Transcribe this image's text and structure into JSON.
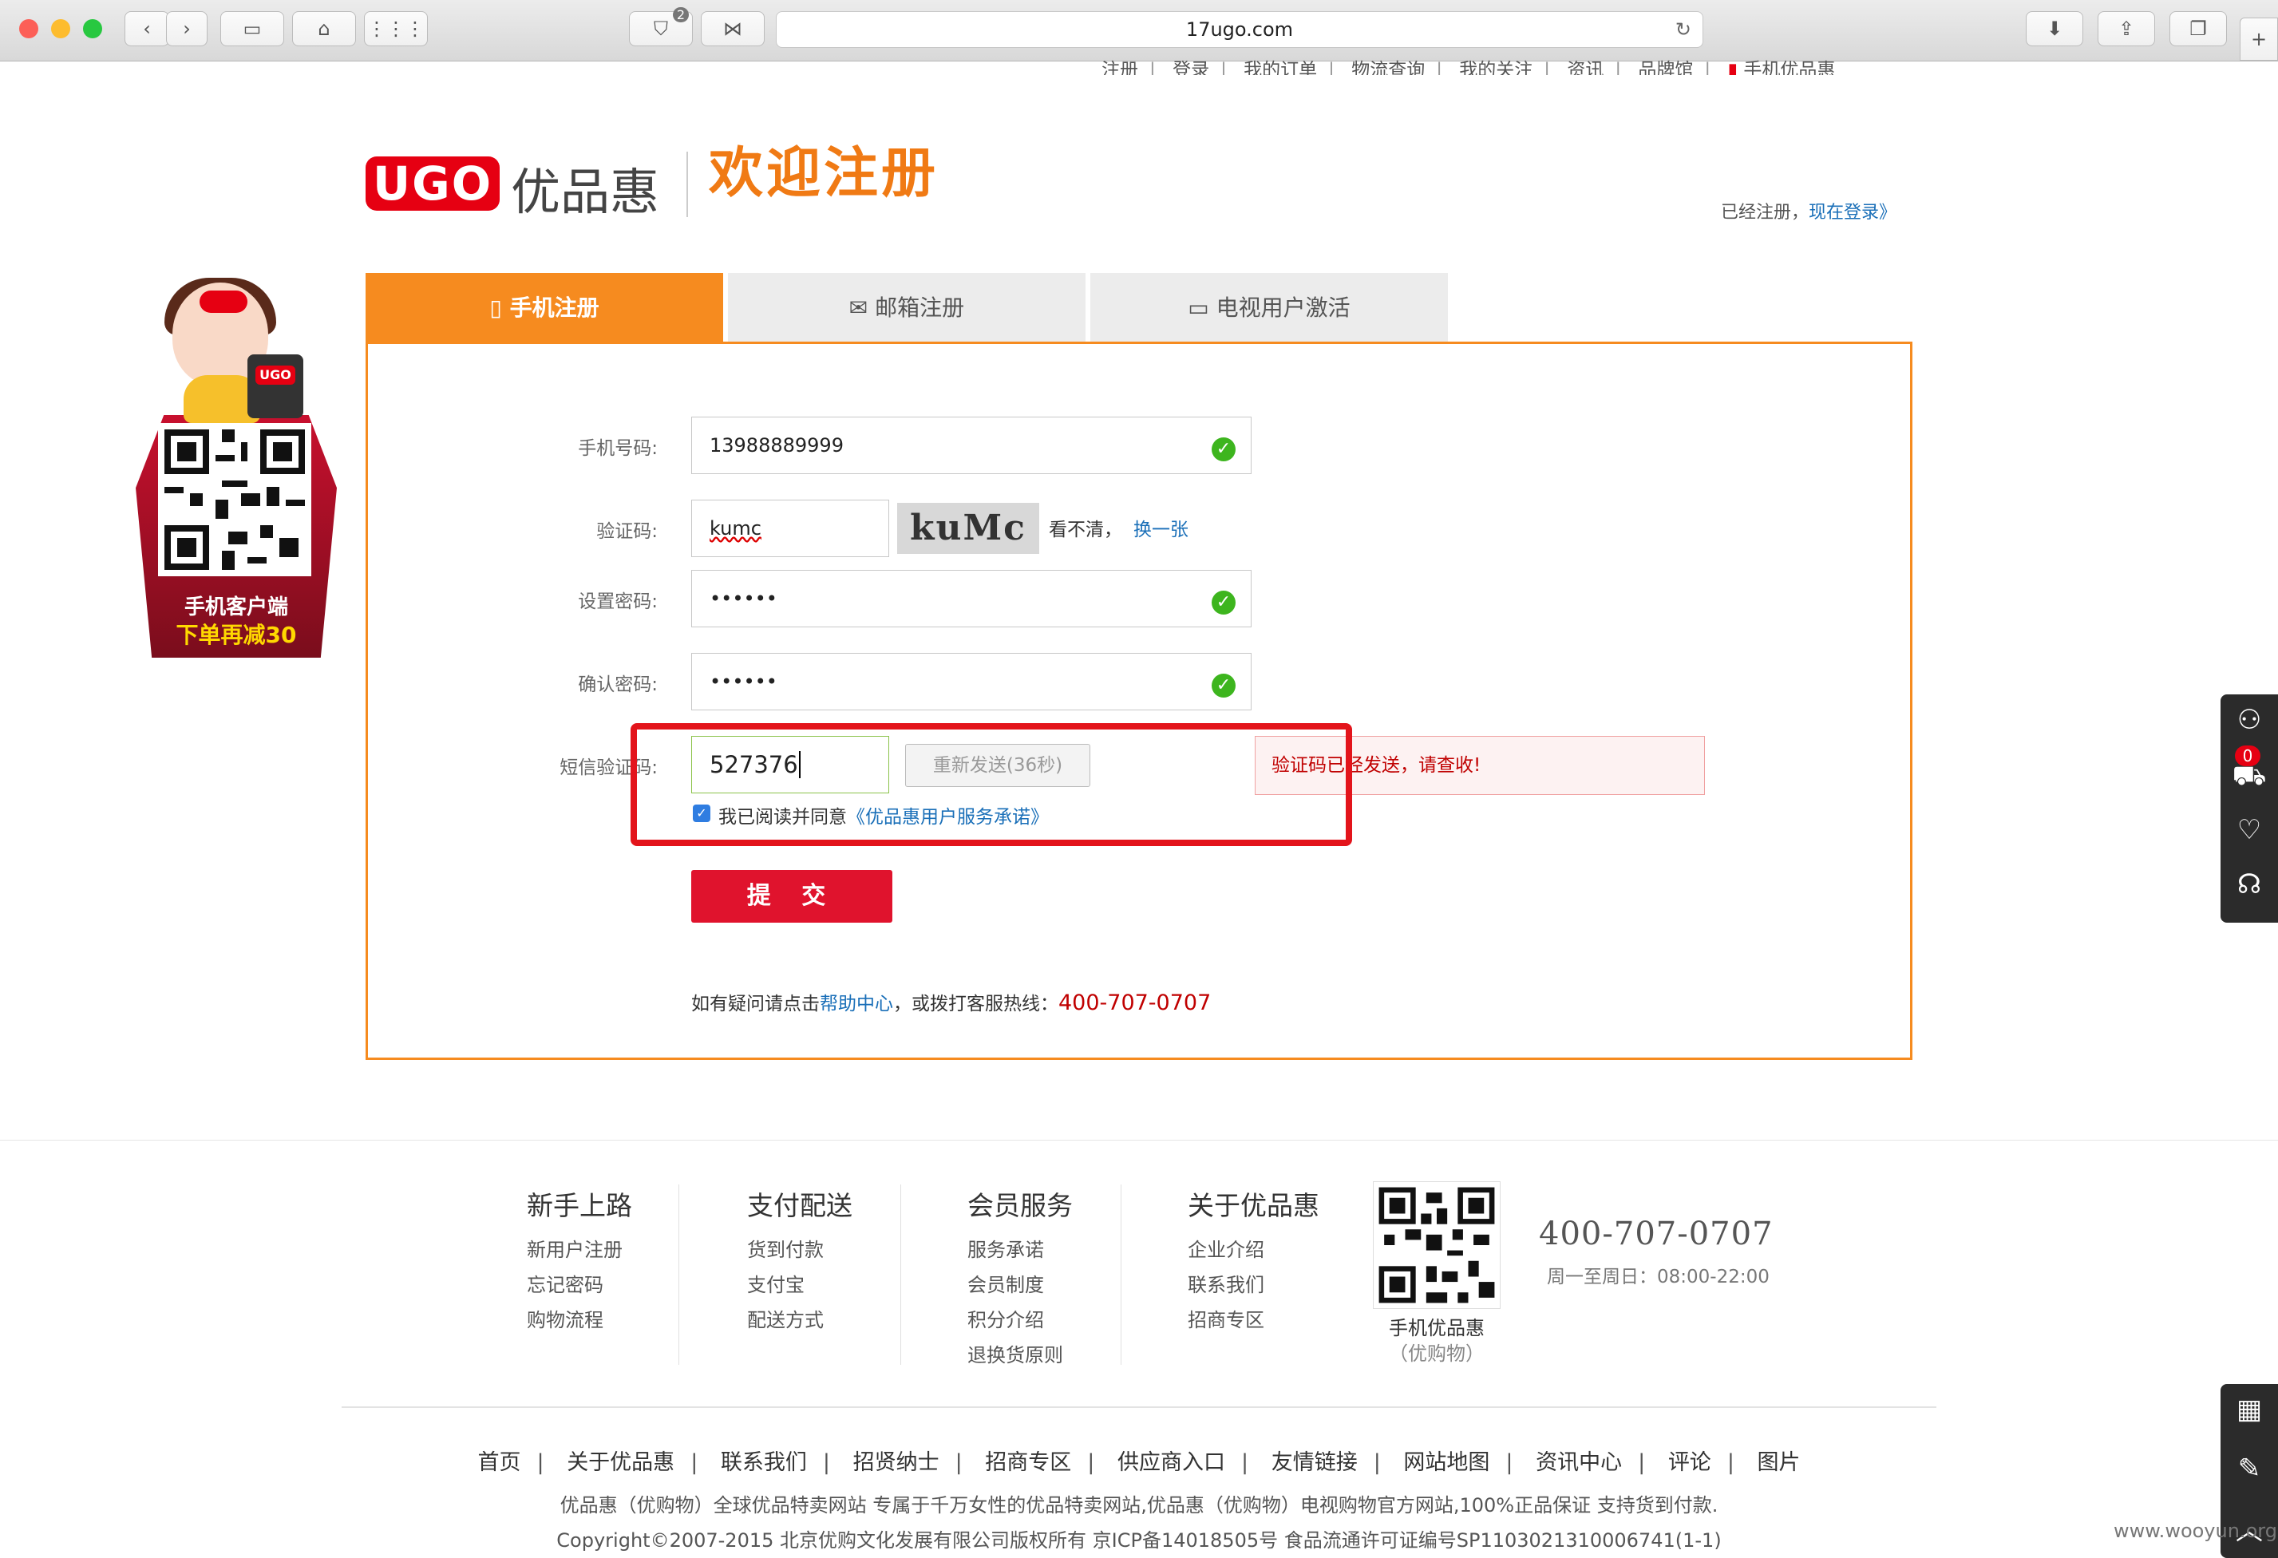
{
  "browser": {
    "url": "17ugo.com",
    "shield_badge": "2"
  },
  "topnav": {
    "items": [
      "注册",
      "登录",
      "我的订单",
      "物流查询",
      "我的关注",
      "资讯",
      "品牌馆",
      "手机优品惠"
    ]
  },
  "header": {
    "logo_text": "UGO",
    "logo_cn": "优品惠",
    "welcome": "欢迎注册",
    "already_text": "已经注册，",
    "login_link": "现在登录》"
  },
  "tabs": [
    {
      "label": "手机注册",
      "active": true,
      "icon": "phone-icon"
    },
    {
      "label": "邮箱注册",
      "active": false,
      "icon": "mail-icon"
    },
    {
      "label": "电视用户激活",
      "active": false,
      "icon": "tv-icon"
    }
  ],
  "form": {
    "phone_label": "手机号码:",
    "phone_value": "13988889999",
    "captcha_label": "验证码:",
    "captcha_value": "kumc",
    "captcha_image_text": "kuMc",
    "captcha_unclear": "看不清，",
    "captcha_refresh": "换一张",
    "password_label": "设置密码:",
    "password_value": "••••••",
    "confirm_label": "确认密码:",
    "confirm_value": "••••••",
    "sms_label": "短信验证码:",
    "sms_value": "527376",
    "resend_label": "重新发送(36秒)",
    "sms_message": "验证码已经发送，请查收!",
    "agree_text": "我已阅读并同意",
    "agree_link": "《优品惠用户服务承诺》",
    "submit_label": "提 交",
    "help_prefix": "如有疑问请点击",
    "help_link": "帮助中心",
    "help_mid": "，或拨打客服热线：",
    "help_phone": "400-707-0707"
  },
  "promo": {
    "line1": "手机客户端",
    "line2": "下单再减30"
  },
  "dock": {
    "cart_count": "0"
  },
  "footer": {
    "columns": [
      {
        "title": "新手上路",
        "items": [
          "新用户注册",
          "忘记密码",
          "购物流程"
        ]
      },
      {
        "title": "支付配送",
        "items": [
          "货到付款",
          "支付宝",
          "配送方式"
        ]
      },
      {
        "title": "会员服务",
        "items": [
          "服务承诺",
          "会员制度",
          "积分介绍",
          "退换货原则"
        ]
      },
      {
        "title": "关于优品惠",
        "items": [
          "企业介绍",
          "联系我们",
          "招商专区"
        ]
      }
    ],
    "qr_caption": "手机优品惠",
    "qr_sub": "（优购物）",
    "phone": "400-707-0707",
    "hours": "周一至周日：08:00-22:00",
    "nav": [
      "首页",
      "关于优品惠",
      "联系我们",
      "招贤纳士",
      "招商专区",
      "供应商入口",
      "友情链接",
      "网站地图",
      "资讯中心",
      "评论",
      "图片"
    ],
    "description": "优品惠（优购物）全球优品特卖网站 专属于千万女性的优品特卖网站,优品惠（优购物）电视购物官方网站,100%正品保证 支持货到付款.",
    "copyright": "Copyright©2007-2015 北京优购文化发展有限公司版权所有 京ICP备14018505号 食品流通许可证编号SP1103021310006741(1-1)"
  },
  "watermark": "www.wooyun.org"
}
